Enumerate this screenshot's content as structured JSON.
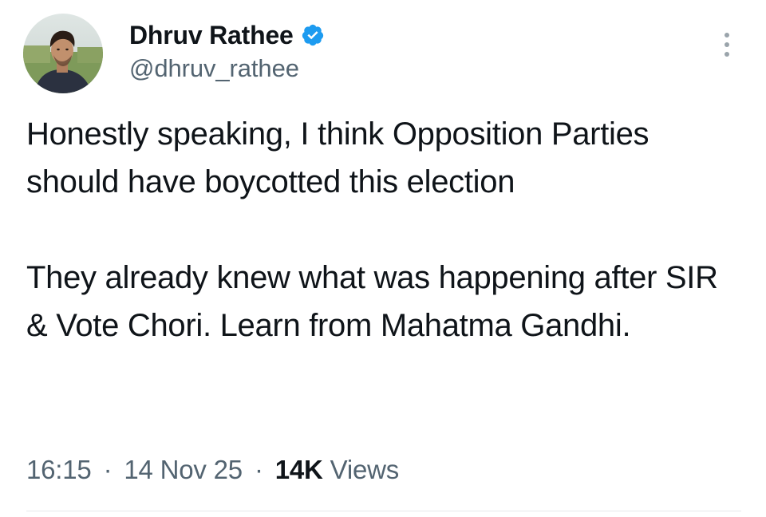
{
  "author": {
    "display_name": "Dhruv Rathee",
    "handle": "@dhruv_rathee",
    "verified": true,
    "verified_color": "#1d9bf0"
  },
  "tweet": {
    "paragraphs": [
      "Honestly speaking, I think Opposition Parties should have boycotted this election",
      "They already knew what was happening after SIR & Vote Chori. Learn from Mahatma Gandhi."
    ]
  },
  "meta": {
    "time": "16:15",
    "separator": "·",
    "date": "14 Nov 25",
    "views_count": "14K",
    "views_label": "Views"
  },
  "icons": {
    "verified": "verified-badge-icon",
    "more": "more-vertical-icon"
  }
}
